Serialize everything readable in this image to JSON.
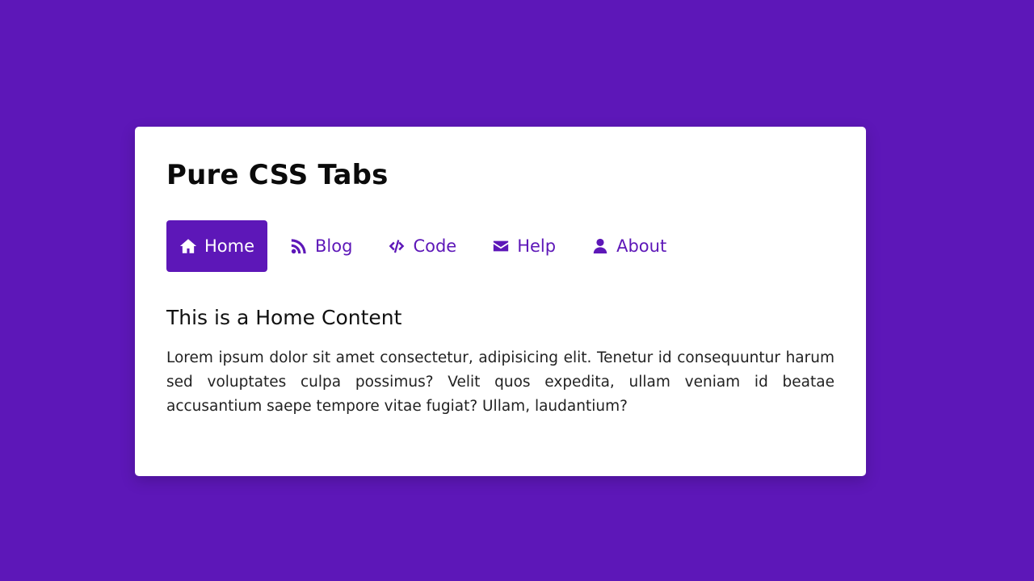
{
  "card": {
    "title": "Pure CSS Tabs"
  },
  "tabs": [
    {
      "label": "Home",
      "icon": "home-icon",
      "active": true
    },
    {
      "label": "Blog",
      "icon": "rss-icon",
      "active": false
    },
    {
      "label": "Code",
      "icon": "code-icon",
      "active": false
    },
    {
      "label": "Help",
      "icon": "envelope-icon",
      "active": false
    },
    {
      "label": "About",
      "icon": "user-icon",
      "active": false
    }
  ],
  "content": {
    "heading": "This is a Home Content",
    "body": "Lorem ipsum dolor sit amet consectetur, adipisicing elit. Tenetur id consequuntur harum sed voluptates culpa possimus? Velit quos expedita, ullam veniam id beatae accusantium saepe tempore vitae fugiat? Ullam, laudantium?"
  },
  "colors": {
    "background": "#5d17b8",
    "accent": "#5d17b8",
    "card": "#ffffff"
  }
}
